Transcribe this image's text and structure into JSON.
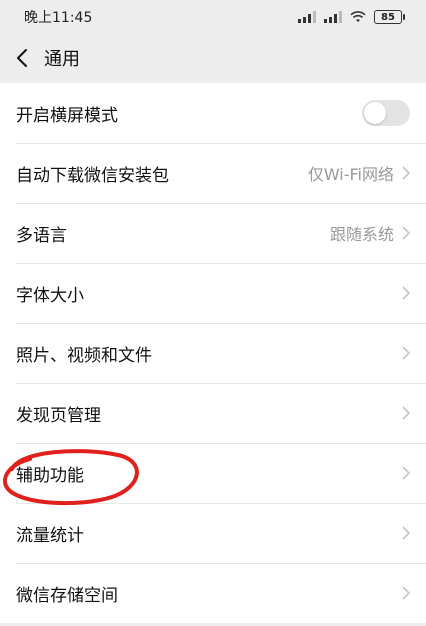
{
  "status_bar": {
    "time": "晚上11:45",
    "battery": "85"
  },
  "nav": {
    "title": "通用"
  },
  "rows": [
    {
      "label": "开启横屏模式"
    },
    {
      "label": "自动下载微信安装包",
      "value": "仅Wi-Fi网络"
    },
    {
      "label": "多语言",
      "value": "跟随系统"
    },
    {
      "label": "字体大小"
    },
    {
      "label": "照片、视频和文件"
    },
    {
      "label": "发现页管理"
    },
    {
      "label": "辅助功能"
    },
    {
      "label": "流量统计"
    },
    {
      "label": "微信存储空间"
    }
  ],
  "colors": {
    "annotation": "#e0201a"
  }
}
